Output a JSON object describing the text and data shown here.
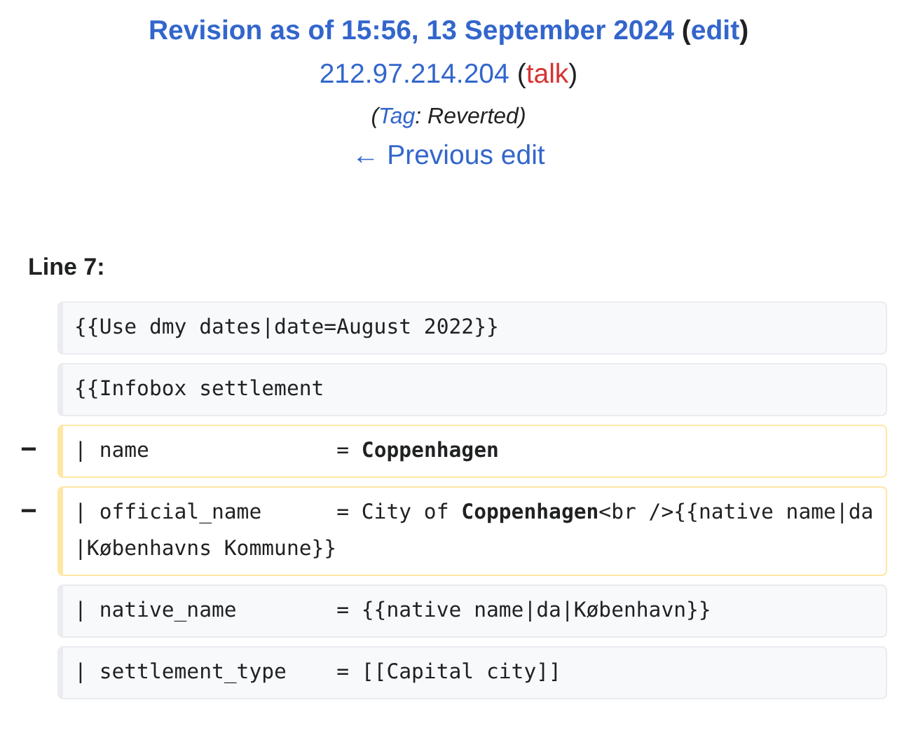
{
  "header": {
    "title": "Revision as of 15:56, 13 September 2024",
    "edit_link": "edit",
    "open_paren": "(",
    "close_paren": ")",
    "user": "212.97.214.204",
    "talk_link": "talk",
    "tag_open": "(",
    "tag_link": "Tag",
    "tag_text": ": Reverted)",
    "previous_edit": "← Previous edit"
  },
  "diff": {
    "heading": "Line 7:",
    "lines": [
      {
        "kind": "context",
        "text": "{{Use dmy dates|date=August 2022}}"
      },
      {
        "kind": "context",
        "text": "{{Infobox settlement"
      },
      {
        "kind": "deleted",
        "marker": "−",
        "text": "| name               = **Coppenhagen**"
      },
      {
        "kind": "deleted",
        "marker": "−",
        "text": "| official_name      = City of **Coppenhagen**<br />{{native name|da|Københavns Kommune}}"
      },
      {
        "kind": "context",
        "text": "| native_name        = {{native name|da|København}}"
      },
      {
        "kind": "context",
        "text": "| settlement_type    = [[Capital city]]"
      }
    ]
  }
}
